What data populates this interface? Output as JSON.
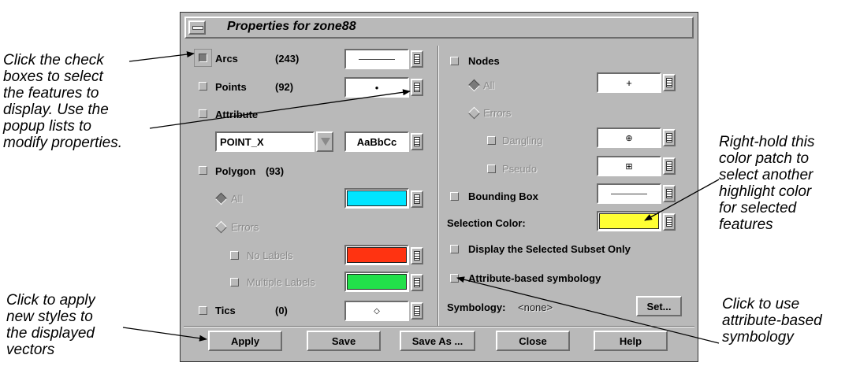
{
  "window": {
    "title": "Properties for zone88"
  },
  "left": {
    "arcs": {
      "label": "Arcs",
      "count": "(243)",
      "checked": true
    },
    "points": {
      "label": "Points",
      "count": "(92)",
      "checked": false,
      "symbol": "•"
    },
    "attribute": {
      "label": "Attribute",
      "field_value": "POINT_X",
      "font_sample": "AaBbCc"
    },
    "polygon": {
      "label": "Polygon",
      "count": "(93)",
      "all_label": "All",
      "errors_label": "Errors",
      "no_labels_label": "No Labels",
      "multiple_labels_label": "Multiple Labels",
      "all_color": "#00e5ff",
      "no_labels_color": "#ff3311",
      "multiple_labels_color": "#22e04a"
    },
    "tics": {
      "label": "Tics",
      "count": "(0)",
      "symbol": "◇"
    }
  },
  "right": {
    "nodes": {
      "label": "Nodes",
      "all_label": "All",
      "all_symbol": "+",
      "errors_label": "Errors",
      "dangling_label": "Dangling",
      "dangling_symbol": "⊕",
      "pseudo_label": "Pseudo",
      "pseudo_symbol": "⊞"
    },
    "bounding_box": {
      "label": "Bounding Box"
    },
    "selection_color": {
      "label": "Selection Color:",
      "color": "#ffff33"
    },
    "display_subset": {
      "label": "Display the Selected Subset Only"
    },
    "attribute_symbology": {
      "label": "Attribute-based symbology"
    },
    "symbology": {
      "label": "Symbology:",
      "value": "<none>",
      "set_button": "Set..."
    }
  },
  "buttons": {
    "apply": "Apply",
    "save": "Save",
    "save_as": "Save As ...",
    "close": "Close",
    "help": "Help"
  },
  "callouts": {
    "check_boxes": "Click the check\nboxes to select\nthe features to\ndisplay. Use the\npopup lists to\nmodify properties.",
    "right_hold": "Right-hold this\ncolor patch to\nselect another\nhighlight color\nfor selected\nfeatures",
    "apply": "Click to apply\nnew styles to\nthe displayed\nvectors",
    "attribute_symbology": "Click to use\nattribute-based\nsymbology"
  }
}
